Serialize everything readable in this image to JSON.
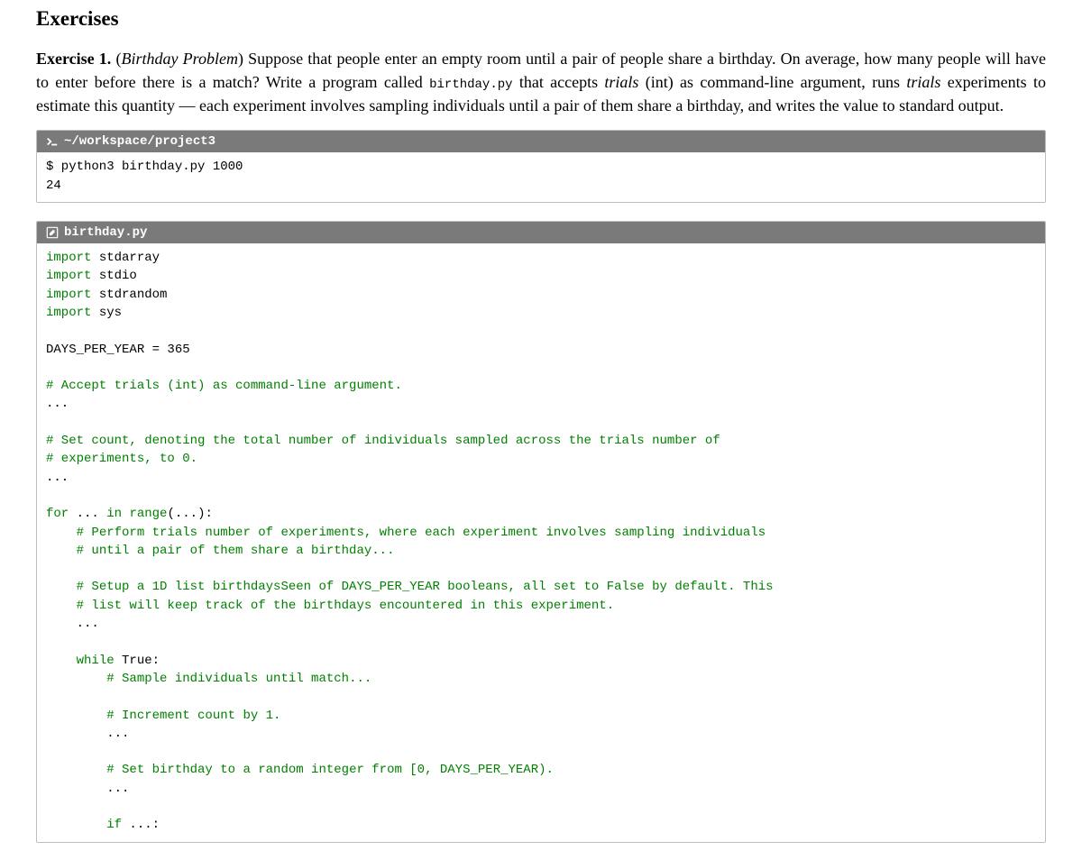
{
  "section_title": "Exercises",
  "exercise": {
    "label": "Exercise 1.",
    "name_open": "(",
    "name": "Birthday Problem",
    "name_close": ")",
    "body_pre": " Suppose that people enter an empty room until a pair of people share a birthday.  On average, how many people will have to enter before there is a match?  Write a program called ",
    "filename": "birthday.py",
    "body_mid1": " that accepts ",
    "arg1": "trials",
    "body_mid2": " (int) as command-line argument, runs ",
    "arg2": "trials",
    "body_mid3": " experiments to estimate this quantity — each experiment involves sampling individuals until a pair of them share a birthday, and writes the value to standard output."
  },
  "terminal": {
    "prompt_icon": "❯_",
    "path": "~/workspace/project3",
    "cmd": "$ python3 birthday.py 1000",
    "out": "24"
  },
  "codebox": {
    "icon_label": "✎",
    "filename": "birthday.py",
    "tokens": [
      {
        "t": "kw",
        "v": "import"
      },
      {
        "t": "txt",
        "v": " stdarray\n"
      },
      {
        "t": "kw",
        "v": "import"
      },
      {
        "t": "txt",
        "v": " stdio\n"
      },
      {
        "t": "kw",
        "v": "import"
      },
      {
        "t": "txt",
        "v": " stdrandom\n"
      },
      {
        "t": "kw",
        "v": "import"
      },
      {
        "t": "txt",
        "v": " sys\n"
      },
      {
        "t": "txt",
        "v": "\n"
      },
      {
        "t": "txt",
        "v": "DAYS_PER_YEAR = 365\n"
      },
      {
        "t": "txt",
        "v": "\n"
      },
      {
        "t": "kw",
        "v": "# Accept trials (int) as command-line argument."
      },
      {
        "t": "txt",
        "v": "\n"
      },
      {
        "t": "txt",
        "v": "...\n"
      },
      {
        "t": "txt",
        "v": "\n"
      },
      {
        "t": "kw",
        "v": "# Set count, denoting the total number of individuals sampled across the trials number of"
      },
      {
        "t": "txt",
        "v": "\n"
      },
      {
        "t": "kw",
        "v": "# experiments, to 0."
      },
      {
        "t": "txt",
        "v": "\n"
      },
      {
        "t": "txt",
        "v": "...\n"
      },
      {
        "t": "txt",
        "v": "\n"
      },
      {
        "t": "kw",
        "v": "for"
      },
      {
        "t": "txt",
        "v": " ... "
      },
      {
        "t": "kw",
        "v": "in"
      },
      {
        "t": "txt",
        "v": " "
      },
      {
        "t": "kw",
        "v": "range"
      },
      {
        "t": "txt",
        "v": "(...):\n"
      },
      {
        "t": "txt",
        "v": "    "
      },
      {
        "t": "kw",
        "v": "# Perform trials number of experiments, where each experiment involves sampling individuals"
      },
      {
        "t": "txt",
        "v": "\n"
      },
      {
        "t": "txt",
        "v": "    "
      },
      {
        "t": "kw",
        "v": "# until a pair of them share a birthday..."
      },
      {
        "t": "txt",
        "v": "\n"
      },
      {
        "t": "txt",
        "v": "\n"
      },
      {
        "t": "txt",
        "v": "    "
      },
      {
        "t": "kw",
        "v": "# Setup a 1D list birthdaysSeen of DAYS_PER_YEAR booleans, all set to False by default. This"
      },
      {
        "t": "txt",
        "v": "\n"
      },
      {
        "t": "txt",
        "v": "    "
      },
      {
        "t": "kw",
        "v": "# list will keep track of the birthdays encountered in this experiment."
      },
      {
        "t": "txt",
        "v": "\n"
      },
      {
        "t": "txt",
        "v": "    ...\n"
      },
      {
        "t": "txt",
        "v": "\n"
      },
      {
        "t": "txt",
        "v": "    "
      },
      {
        "t": "kw",
        "v": "while"
      },
      {
        "t": "txt",
        "v": " True:\n"
      },
      {
        "t": "txt",
        "v": "        "
      },
      {
        "t": "kw",
        "v": "# Sample individuals until match..."
      },
      {
        "t": "txt",
        "v": "\n"
      },
      {
        "t": "txt",
        "v": "\n"
      },
      {
        "t": "txt",
        "v": "        "
      },
      {
        "t": "kw",
        "v": "# Increment count by 1."
      },
      {
        "t": "txt",
        "v": "\n"
      },
      {
        "t": "txt",
        "v": "        ...\n"
      },
      {
        "t": "txt",
        "v": "\n"
      },
      {
        "t": "txt",
        "v": "        "
      },
      {
        "t": "kw",
        "v": "# Set birthday to a random integer from [0, DAYS_PER_YEAR)."
      },
      {
        "t": "txt",
        "v": "\n"
      },
      {
        "t": "txt",
        "v": "        ...\n"
      },
      {
        "t": "txt",
        "v": "\n"
      },
      {
        "t": "txt",
        "v": "        "
      },
      {
        "t": "kw",
        "v": "if"
      },
      {
        "t": "txt",
        "v": " ...:"
      }
    ]
  }
}
